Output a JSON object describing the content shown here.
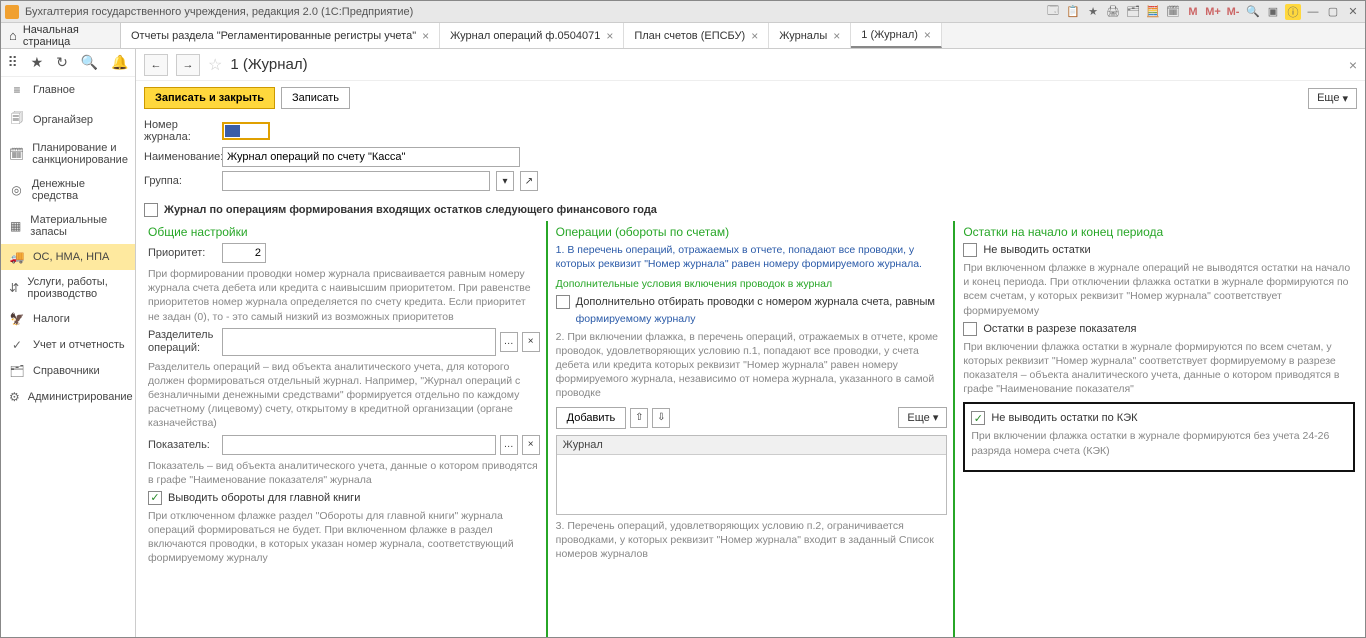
{
  "title": "Бухгалтерия государственного учреждения, редакция 2.0  (1С:Предприятие)",
  "tabs": {
    "home": "Начальная страница",
    "items": [
      {
        "label": "Отчеты раздела \"Регламентированные регистры учета\""
      },
      {
        "label": "Журнал операций ф.0504071"
      },
      {
        "label": "План счетов (ЕПСБУ)"
      },
      {
        "label": "Журналы"
      },
      {
        "label": "1 (Журнал)"
      }
    ]
  },
  "nav": [
    {
      "icon": "≡",
      "label": "Главное"
    },
    {
      "icon": "🗐",
      "label": "Органайзер"
    },
    {
      "icon": "🗓",
      "label": "Планирование и санкционирование"
    },
    {
      "icon": "◎",
      "label": "Денежные средства"
    },
    {
      "icon": "▦",
      "label": "Материальные запасы"
    },
    {
      "icon": "🚚",
      "label": "ОС, НМА, НПА"
    },
    {
      "icon": "⇵",
      "label": "Услуги, работы, производство"
    },
    {
      "icon": "🦅",
      "label": "Налоги"
    },
    {
      "icon": "✓",
      "label": "Учет и отчетность"
    },
    {
      "icon": "🗂",
      "label": "Справочники"
    },
    {
      "icon": "⚙",
      "label": "Администрирование"
    }
  ],
  "header": {
    "title": "1 (Журнал)"
  },
  "toolbar": {
    "save_close": "Записать и закрыть",
    "save": "Записать",
    "more": "Еще"
  },
  "form": {
    "num_label": "Номер журнала:",
    "name_label": "Наименование:",
    "name_value": "Журнал операций по счету \"Касса\"",
    "group_label": "Группа:",
    "incoming_chk": "Журнал по операциям формирования входящих остатков следующего финансового года"
  },
  "col1": {
    "title": "Общие настройки",
    "priority_label": "Приоритет:",
    "priority_value": "2",
    "text1": "При формировании проводки номер журнала присваивается равным номеру журнала счета дебета или кредита с наивысшим приоритетом. При равенстве приоритетов номер журнала определяется по счету кредита. Если приоритет не задан (0), то - это самый низкий из возможных приоритетов",
    "sep_label": "Разделитель операций:",
    "text2": "Разделитель операций – вид объекта аналитического учета, для которого должен формироваться отдельный журнал. Например, \"Журнал операций с безналичными денежными средствами\" формируется отдельно по каждому расчетному (лицевому) счету, открытому в кредитной организации (органе казначейства)",
    "ind_label": "Показатель:",
    "text3": "Показатель – вид объекта аналитического учета, данные о котором приводятся в графе \"Наименование показателя\" журнала",
    "chk_main_book": "Выводить обороты для главной книги",
    "text4": "При отключенном флажке раздел \"Обороты для главной книги\" журнала операций формироваться не будет. При включенном флажке в раздел включаются проводки, в которых указан номер журнала, соответствующий формируемому журналу"
  },
  "col2": {
    "title": "Операции (обороты по счетам)",
    "link1": "1. В перечень операций, отражаемых в отчете, попадают все проводки, у которых реквизит \"Номер журнала\" равен номеру формируемого журнала.",
    "sub_green": "Дополнительные условия включения проводок в журнал",
    "chk_extra": "Дополнительно отбирать проводки с номером журнала счета, равным",
    "sub_link": "формируемому журналу",
    "text1": "2. При включении флажка, в перечень операций, отражаемых в отчете, кроме проводок, удовлетворяющих условию п.1, попадают все проводки, у счета дебета или кредита которых реквизит \"Номер журнала\" равен номеру формируемого журнала, независимо от номера журнала, указанного в самой проводке",
    "add": "Добавить",
    "more": "Еще",
    "list_header": "Журнал",
    "text2": "3. Перечень операций, удовлетворяющих условию п.2, ограничивается проводками, у которых реквизит \"Номер журнала\" входит в заданный Список номеров журналов"
  },
  "col3": {
    "title": "Остатки на начало и конец периода",
    "chk1": "Не выводить остатки",
    "text1": "При включенном флажке в журнале операций не выводятся остатки на начало и конец периода. При отключении флажка остатки в журнале формируются по всем счетам, у которых реквизит \"Номер журнала\" соответствует формируемому",
    "chk2": "Остатки в разрезе показателя",
    "text2": "При включении флажка остатки в журнале формируются по всем счетам, у которых реквизит \"Номер журнала\" соответствует формируемому в разрезе показателя – объекта аналитического учета, данные о котором приводятся в графе \"Наименование показателя\"",
    "chk3": "Не выводить остатки по КЭК",
    "text3": "При включении флажка остатки в журнале формируются без учета 24-26 разряда номера счета (КЭК)"
  }
}
